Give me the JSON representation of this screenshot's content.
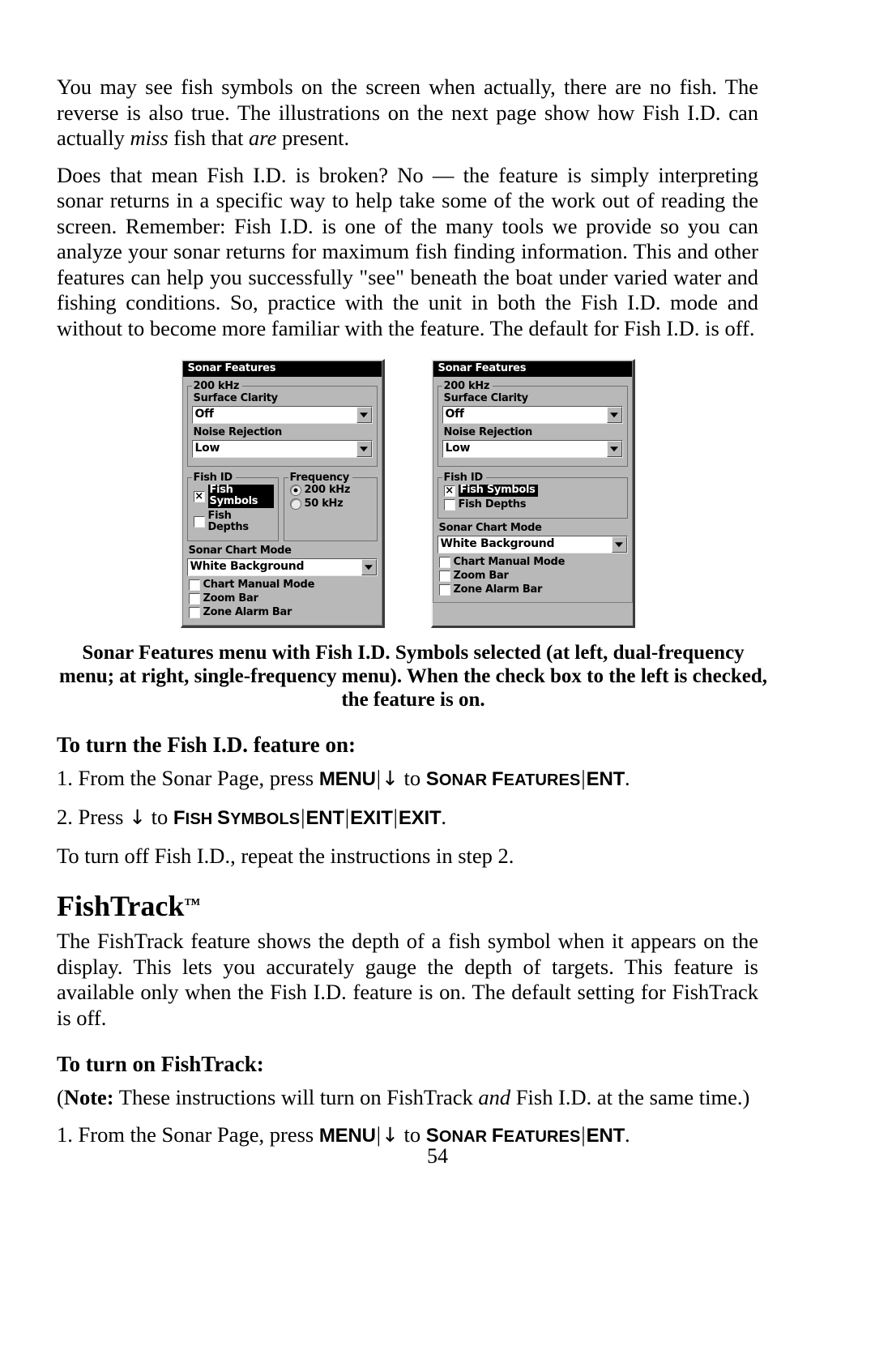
{
  "page": {
    "number": "54"
  },
  "paragraphs": {
    "p1_a": "You may see fish symbols on the screen when actually, there are no fish. The reverse is also true. The illustrations on the next page show how Fish I.D. can actually ",
    "p1_i1": "miss",
    "p1_b": " fish that ",
    "p1_i2": "are",
    "p1_c": " present.",
    "p2": "Does that mean Fish I.D. is broken? No — the feature is simply interpreting sonar returns in a specific way to help take some of the work out of reading the screen. Remember: Fish I.D. is one of the many tools we provide so you can analyze your sonar returns for maximum fish finding information. This and other features can help you successfully \"see\" beneath the boat under varied water and fishing conditions. So, practice with the unit in both the Fish I.D. mode and without to become more familiar with the feature. The default for Fish I.D. is off.",
    "p3": "To turn off Fish I.D., repeat the instructions in step 2.",
    "p4": "The FishTrack feature shows the depth of a fish symbol when it appears on the display. This lets you accurately gauge the depth of targets. This feature is available only when the Fish I.D. feature is on. The default setting for FishTrack is off.",
    "note_label": "Note:",
    "note_a": "(",
    "note_b": " These instructions will turn on FishTrack ",
    "note_i": "and",
    "note_c": " Fish I.D. at the same time.)"
  },
  "figure": {
    "caption": "Sonar Features menu with Fish I.D. Symbols selected (at left, dual-frequency menu; at right, single-frequency menu). When the check box to the left is checked, the feature is on.",
    "dialogs": [
      {
        "id": "dual-frequency",
        "title": "Sonar Features",
        "group_frequency_label": "200 kHz",
        "surface_clarity_label": "Surface Clarity",
        "surface_clarity_value": "Off",
        "noise_rejection_label": "Noise Rejection",
        "noise_rejection_value": "Low",
        "fish_id_label": "Fish ID",
        "fish_symbols_label": "Fish Symbols",
        "fish_symbols_checked": true,
        "fish_symbols_selected": true,
        "fish_depths_label": "Fish Depths",
        "fish_depths_checked": false,
        "frequency_label": "Frequency",
        "freq_options": [
          {
            "label": "200 kHz",
            "selected": true
          },
          {
            "label": "50 kHz",
            "selected": false
          }
        ],
        "sonar_chart_mode_label": "Sonar Chart Mode",
        "sonar_chart_mode_value": "White Background",
        "chart_manual_mode_label": "Chart Manual Mode",
        "chart_manual_mode_checked": false,
        "zoom_bar_label": "Zoom Bar",
        "zoom_bar_checked": false,
        "zone_alarm_bar_label": "Zone Alarm Bar",
        "zone_alarm_bar_checked": false,
        "has_frequency_group": true
      },
      {
        "id": "single-frequency",
        "title": "Sonar Features",
        "group_frequency_label": "200 kHz",
        "surface_clarity_label": "Surface Clarity",
        "surface_clarity_value": "Off",
        "noise_rejection_label": "Noise Rejection",
        "noise_rejection_value": "Low",
        "fish_id_label": "Fish ID",
        "fish_symbols_label": "Fish Symbols",
        "fish_symbols_checked": true,
        "fish_symbols_selected": true,
        "fish_depths_label": "Fish Depths",
        "fish_depths_checked": false,
        "sonar_chart_mode_label": "Sonar Chart Mode",
        "sonar_chart_mode_value": "White Background",
        "chart_manual_mode_label": "Chart Manual Mode",
        "chart_manual_mode_checked": false,
        "zoom_bar_label": "Zoom Bar",
        "zoom_bar_checked": false,
        "zone_alarm_bar_label": "Zone Alarm Bar",
        "zone_alarm_bar_checked": false,
        "has_frequency_group": false
      }
    ]
  },
  "headings": {
    "fish_id_on": "To turn the Fish I.D. feature on:",
    "fishtrack": "FishTrack",
    "fishtrack_tm": "™",
    "fishtrack_on": "To turn on FishTrack:"
  },
  "steps": {
    "s1_num": "1. ",
    "s1_a": "From the Sonar Page, press ",
    "s1_key1": "MENU",
    "s1_sep1": "|",
    "s1_arrow": "↓",
    "s1_to": " to ",
    "s1_sc_cap1": "S",
    "s1_sc_rest1": "ONAR",
    "s1_sc_space": " ",
    "s1_sc_cap2": "F",
    "s1_sc_rest2": "EATURES",
    "s1_sep2": "|",
    "s1_key2": "ENT",
    "s1_end": ".",
    "s2_num": "2. ",
    "s2_a": "Press ",
    "s2_arrow": "↓",
    "s2_to": " to ",
    "s2_sc_cap1": "F",
    "s2_sc_rest1": "ISH",
    "s2_sc_cap2": "S",
    "s2_sc_rest2": "YMBOLS",
    "s2_key_ent": "ENT",
    "s2_key_exit1": "EXIT",
    "s2_key_exit2": "EXIT",
    "s2_end": "."
  }
}
